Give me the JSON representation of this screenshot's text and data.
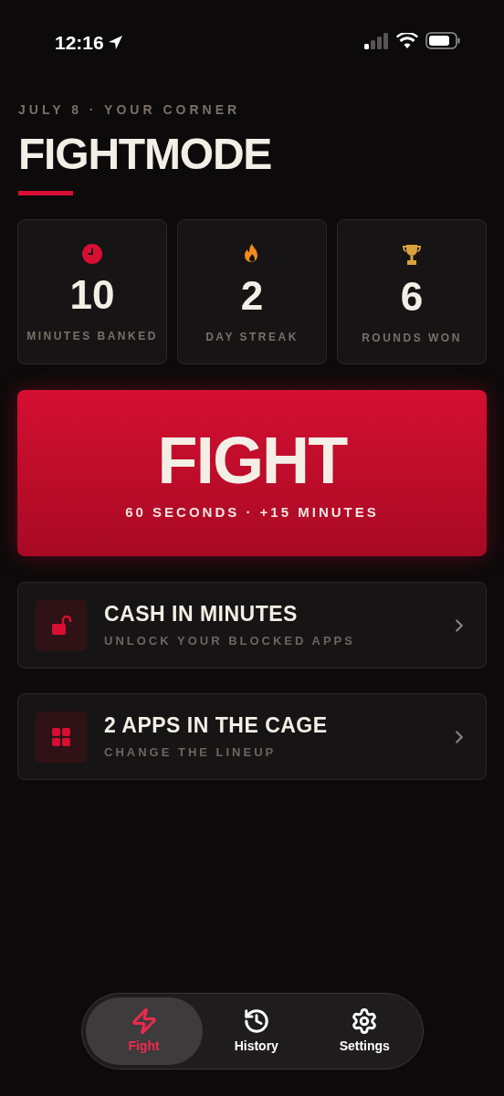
{
  "status_bar": {
    "time": "12:16"
  },
  "header": {
    "eyebrow": "JULY 8 · YOUR CORNER",
    "title": "FIGHTMODE"
  },
  "stats": [
    {
      "kind": "clock",
      "value": "10",
      "label": "MINUTES BANKED",
      "color": "#d70f32"
    },
    {
      "kind": "flame",
      "value": "2",
      "label": "DAY STREAK",
      "color": "#f28a1e"
    },
    {
      "kind": "trophy",
      "value": "6",
      "label": "ROUNDS WON",
      "color": "#d9a23a"
    }
  ],
  "fight_button": {
    "title": "FIGHT",
    "subtitle": "60 SECONDS · +15 MINUTES"
  },
  "actions": [
    {
      "kind": "unlock",
      "title": "CASH IN MINUTES",
      "subtitle": "UNLOCK YOUR BLOCKED APPS"
    },
    {
      "kind": "grid",
      "title": "2 APPS IN THE CAGE",
      "subtitle": "CHANGE THE LINEUP"
    }
  ],
  "tab_bar": [
    {
      "kind": "bolt",
      "label": "Fight",
      "selected": true
    },
    {
      "kind": "history",
      "label": "History",
      "selected": false
    },
    {
      "kind": "settings",
      "label": "Settings",
      "selected": false
    }
  ]
}
